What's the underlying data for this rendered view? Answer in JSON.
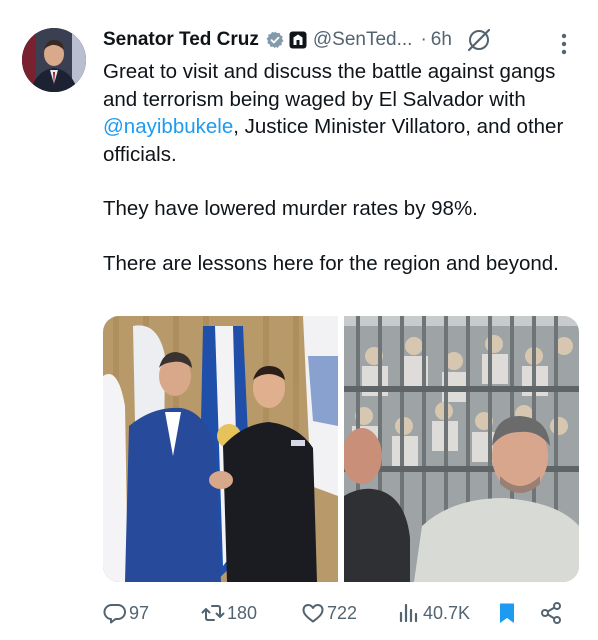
{
  "author": {
    "name": "Senator Ted Cruz",
    "handle": "@SenTed...",
    "separator": "·",
    "time": "6h"
  },
  "tweet": {
    "line1_before": "Great to visit and discuss the battle against gangs and terrorism being waged by El Salvador with ",
    "mention": "@nayibbukele",
    "line1_after": ", Justice Minister Villatoro, and other officials.",
    "paragraph2": "They have lowered murder rates by 98%.",
    "paragraph3": "There are lessons here for the region and beyond."
  },
  "actions": {
    "replies": "97",
    "reposts": "180",
    "likes": "722",
    "views": "40.7K"
  },
  "icons": {
    "verified": "verified-badge-icon",
    "affiliation": "government-affiliation-icon",
    "grok": "grok-icon",
    "more": "more-options-icon",
    "reply": "reply-icon",
    "repost": "repost-icon",
    "like": "heart-icon",
    "views": "views-chart-icon",
    "bookmark": "bookmark-icon",
    "share": "share-icon"
  },
  "colors": {
    "accent": "#1d9bf0",
    "text": "#0f1419",
    "muted": "#536471"
  }
}
